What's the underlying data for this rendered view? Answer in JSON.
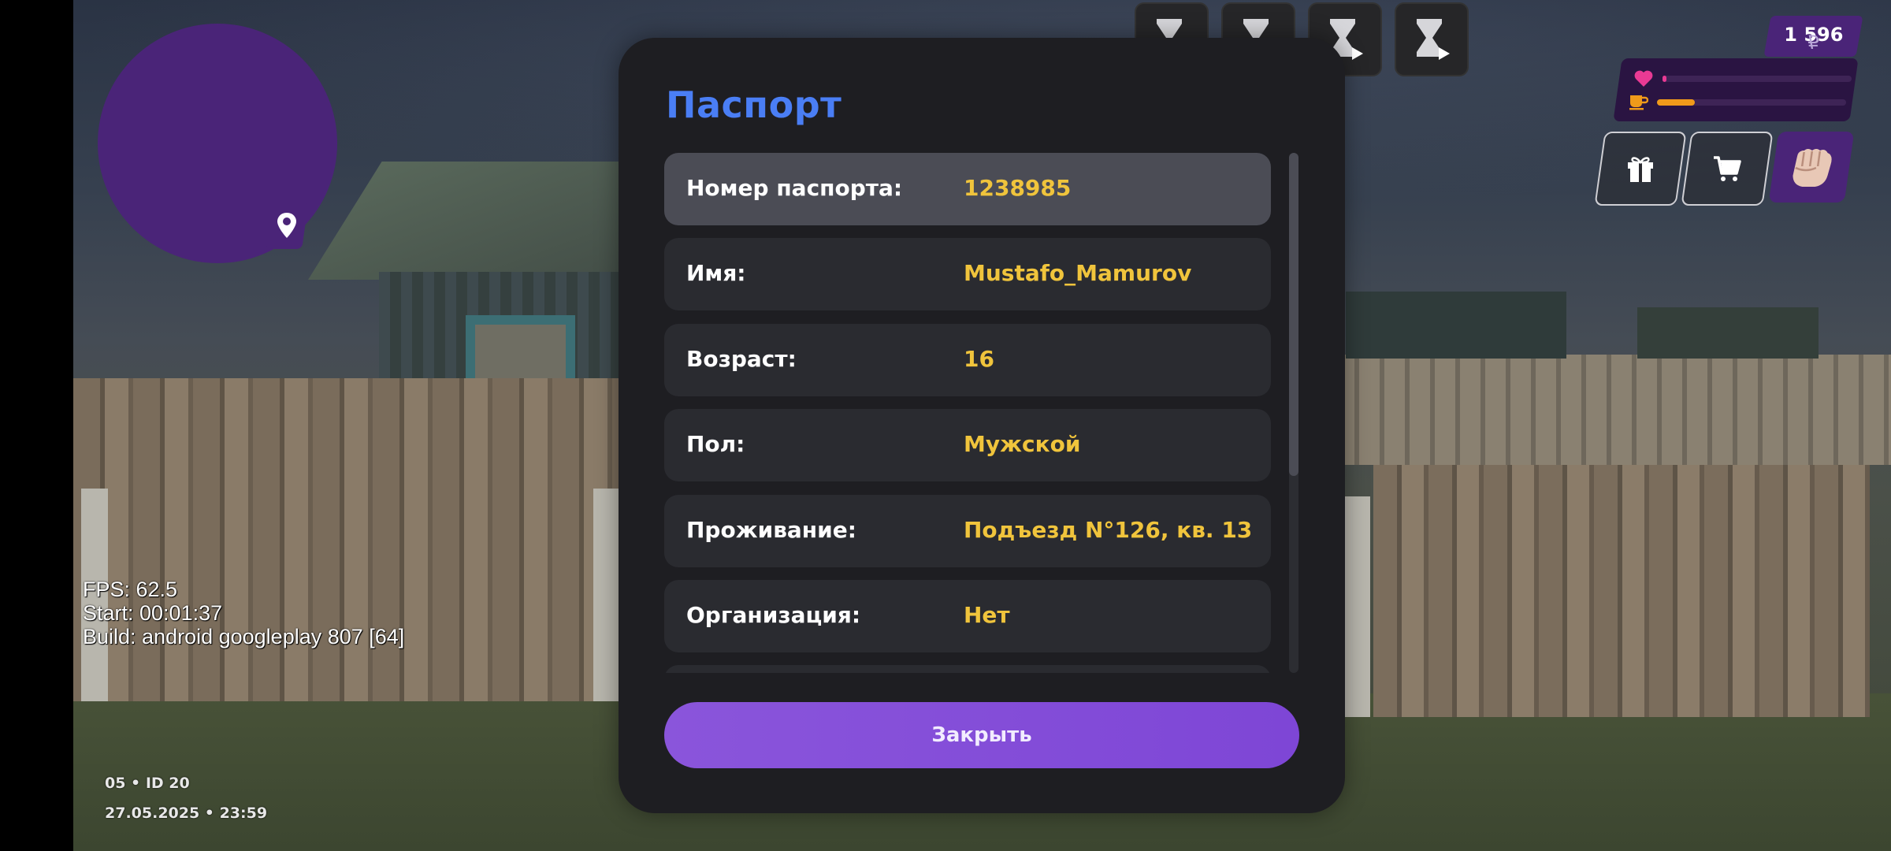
{
  "hud": {
    "money_currency": "₽",
    "money_value": "1 596",
    "health_level": 0.02,
    "hunger_level": 0.2,
    "icons": [
      "hourglass-play-icon",
      "heart-icon",
      "cup-icon",
      "gift-icon",
      "cart-icon",
      "fist-icon",
      "map-pin-icon"
    ]
  },
  "debug": {
    "fps": "FPS: 62.5",
    "start": "Start: 00:01:37",
    "build": "Build: android googleplay 807 [64]"
  },
  "server": {
    "id": "05 • ID 20",
    "datetime": "27.05.2025 • 23:59"
  },
  "passport": {
    "title": "Паспорт",
    "rows": [
      {
        "label": "Номер паспорта:",
        "value": "1238985"
      },
      {
        "label": "Имя:",
        "value": "Mustafo_Mamurov"
      },
      {
        "label": "Возраст:",
        "value": "16"
      },
      {
        "label": "Пол:",
        "value": "Мужской"
      },
      {
        "label": "Проживание:",
        "value": "Подъезд N°126, кв. 13"
      },
      {
        "label": "Организация:",
        "value": "Нет"
      }
    ],
    "close_label": "Закрыть"
  },
  "colors": {
    "title": "#4a7ef5",
    "value": "#f0c43c",
    "accent_purple": "#4a2478",
    "button": "#8a55db",
    "health": "#e93a94",
    "hunger": "#f09a1a"
  }
}
